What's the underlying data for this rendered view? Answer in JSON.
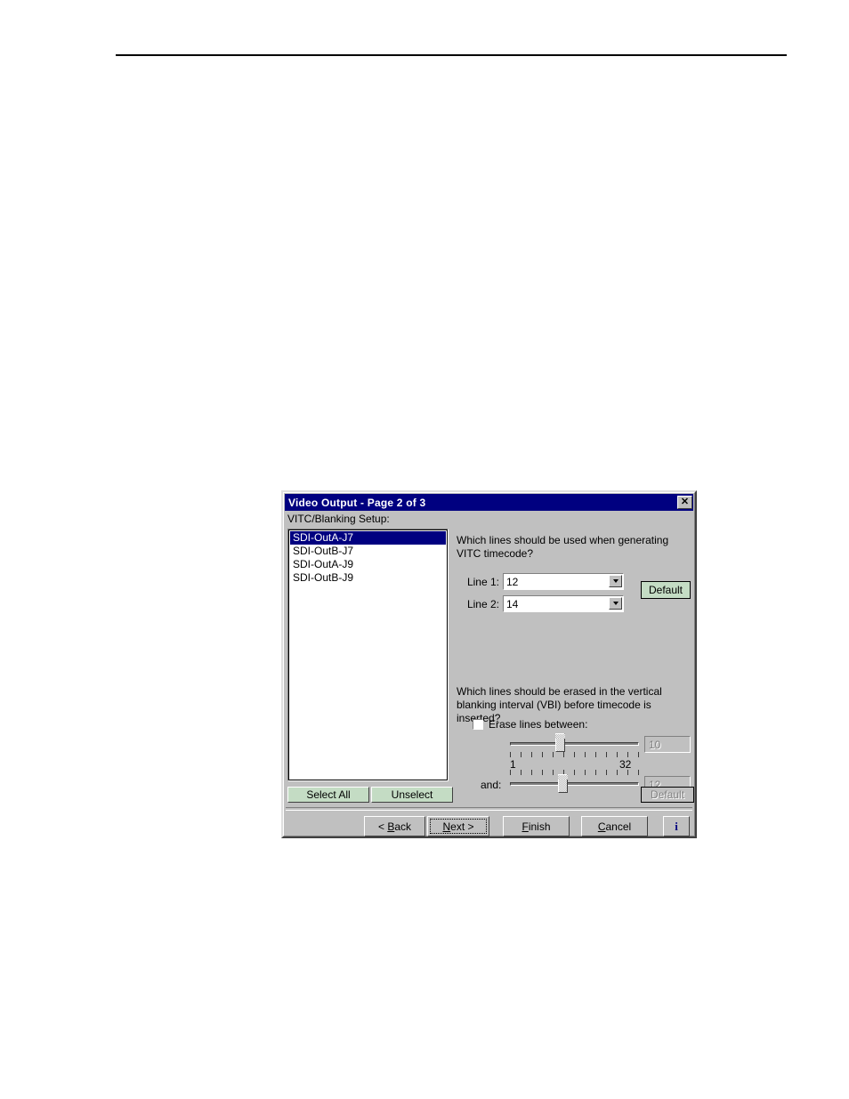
{
  "dialog": {
    "title": "Video Output - Page 2 of 3",
    "close_label": "✕",
    "left_panel": {
      "label": "VITC/Blanking Setup:",
      "items": [
        {
          "label": "SDI-OutA-J7",
          "selected": true
        },
        {
          "label": "SDI-OutB-J7",
          "selected": false
        },
        {
          "label": "SDI-OutA-J9",
          "selected": false
        },
        {
          "label": "SDI-OutB-J9",
          "selected": false
        }
      ],
      "select_all_label": "Select All",
      "unselect_label": "Unselect"
    },
    "vitc_section": {
      "question": "Which lines should be used when generating VITC timecode?",
      "line1_label": "Line 1:",
      "line1_value": "12",
      "line2_label": "Line 2:",
      "line2_value": "14",
      "default_label": "Default"
    },
    "vbi_section": {
      "question": "Which lines should be erased in the vertical blanking interval (VBI) before timecode is inserted?",
      "checkbox_label": "Erase lines between:",
      "checkbox_checked": false,
      "slider_min_label": "1",
      "slider_max_label": "32",
      "slider1_value": "10",
      "and_label": "and:",
      "slider2_value": "12",
      "default_label": "Default",
      "default_disabled": true
    },
    "nav": {
      "back_label": "< Back",
      "next_label": "Next >",
      "finish_label": "Finish",
      "cancel_label": "Cancel",
      "info_label": "i"
    },
    "colors": {
      "titlebar": "#000080",
      "face": "#c0c0c0",
      "green_button": "#c4dcc4",
      "selection": "#000080",
      "disabled_text": "#808080"
    }
  }
}
